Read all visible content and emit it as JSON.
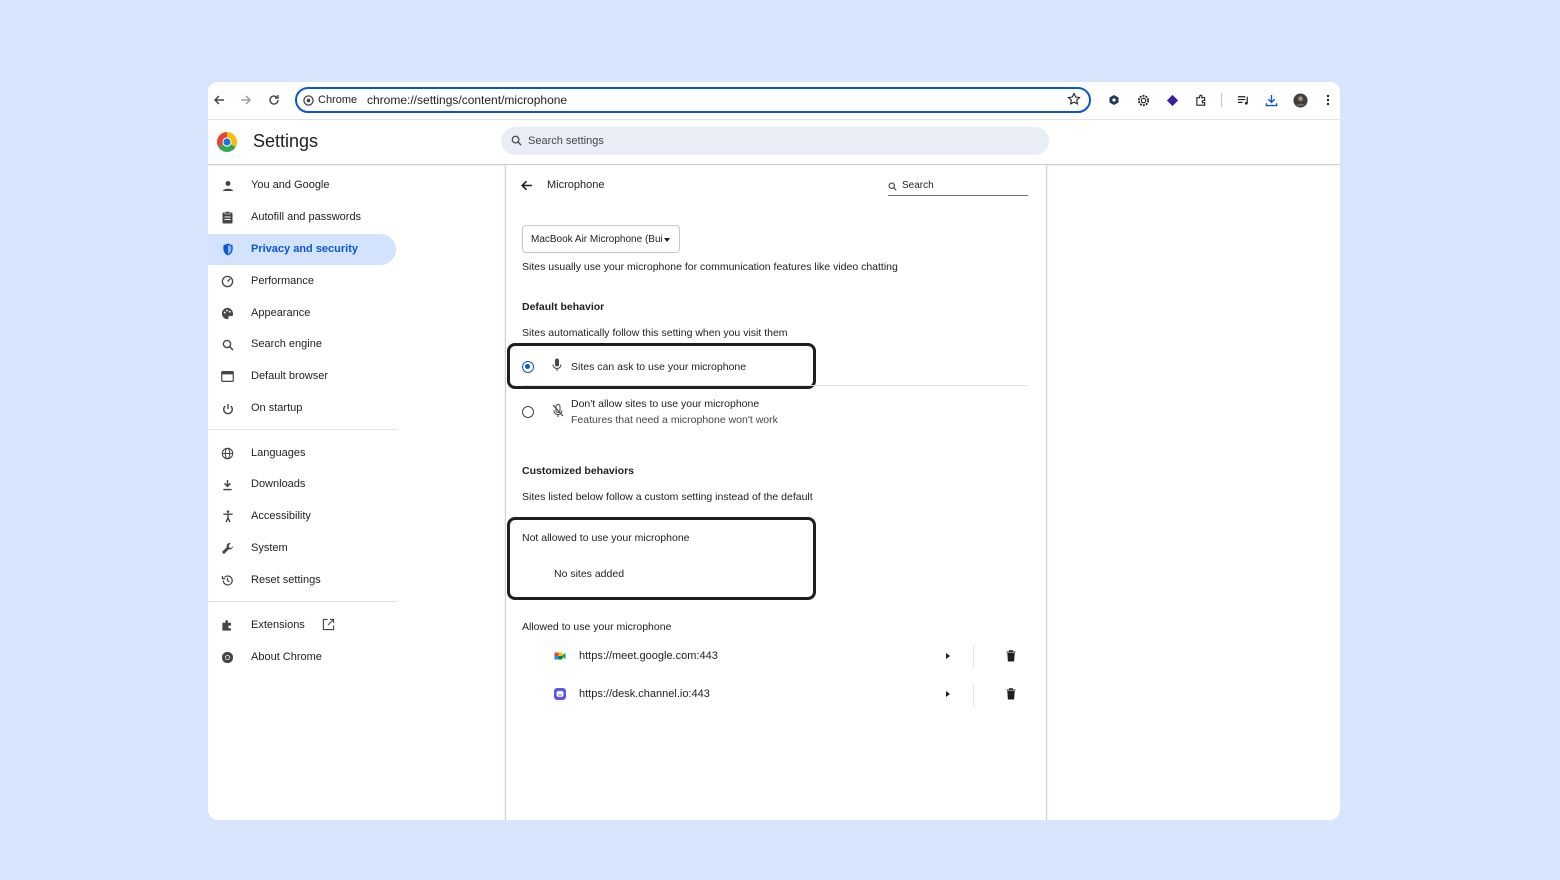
{
  "toolbar": {
    "site_chip": "Chrome",
    "url": "chrome://settings/content/microphone"
  },
  "header": {
    "title": "Settings",
    "search_placeholder": "Search settings"
  },
  "sidebar": {
    "items": [
      {
        "label": "You and Google",
        "icon": "person-icon"
      },
      {
        "label": "Autofill and passwords",
        "icon": "clipboard-icon"
      },
      {
        "label": "Privacy and security",
        "icon": "shield-icon",
        "active": true
      },
      {
        "label": "Performance",
        "icon": "speedometer-icon"
      },
      {
        "label": "Appearance",
        "icon": "palette-icon"
      },
      {
        "label": "Search engine",
        "icon": "search-icon"
      },
      {
        "label": "Default browser",
        "icon": "browser-icon"
      },
      {
        "label": "On startup",
        "icon": "power-icon"
      },
      {
        "label": "Languages",
        "icon": "globe-icon"
      },
      {
        "label": "Downloads",
        "icon": "download-icon"
      },
      {
        "label": "Accessibility",
        "icon": "accessibility-icon"
      },
      {
        "label": "System",
        "icon": "wrench-icon"
      },
      {
        "label": "Reset settings",
        "icon": "history-icon"
      },
      {
        "label": "Extensions",
        "icon": "puzzle-icon"
      },
      {
        "label": "About Chrome",
        "icon": "chrome-icon"
      }
    ]
  },
  "content": {
    "page_title": "Microphone",
    "search_label": "Search",
    "device_selected": "MacBook Air Microphone (Bui",
    "device_description": "Sites usually use your microphone for communication features like video chatting",
    "default_behavior": {
      "heading": "Default behavior",
      "description": "Sites automatically follow this setting when you visit them",
      "option_allow": "Sites can ask to use your microphone",
      "option_block": "Don't allow sites to use your microphone",
      "option_block_sub": "Features that need a microphone won't work"
    },
    "customized": {
      "heading": "Customized behaviors",
      "description": "Sites listed below follow a custom setting instead of the default",
      "not_allowed_heading": "Not allowed to use your microphone",
      "no_sites": "No sites added",
      "allowed_heading": "Allowed to use your microphone",
      "allowed_sites": [
        {
          "url": "https://meet.google.com:443",
          "icon": "google-meet-icon"
        },
        {
          "url": "https://desk.channel.io:443",
          "icon": "channel-talk-icon"
        }
      ]
    }
  },
  "colors": {
    "accent": "#0b57d0",
    "active_nav_bg": "#d3e3fd",
    "page_bg": "#d8e6fd"
  }
}
